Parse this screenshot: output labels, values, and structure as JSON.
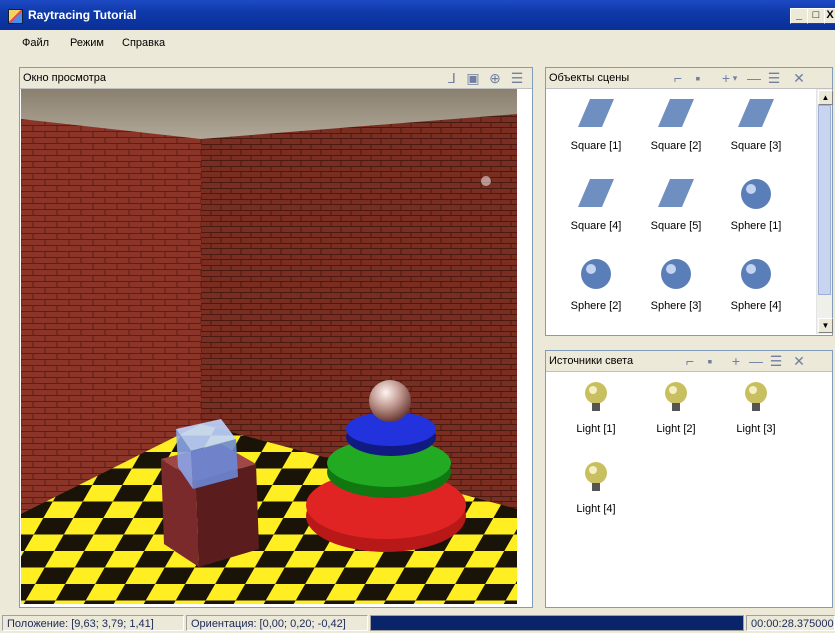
{
  "window": {
    "title": "Raytracing Tutorial",
    "minimize": "_",
    "maximize": "□",
    "close": "X"
  },
  "menu": [
    "Файл",
    "Режим",
    "Справка"
  ],
  "viewport": {
    "title": "Окно просмотра"
  },
  "scene_objects": {
    "title": "Объекты сцены",
    "items": [
      "Square [1]",
      "Square [2]",
      "Square [3]",
      "Square [4]",
      "Square [5]",
      "Sphere [1]",
      "Sphere [2]",
      "Sphere [3]",
      "Sphere [4]"
    ]
  },
  "lights": {
    "title": "Источники света",
    "items": [
      "Light [1]",
      "Light [2]",
      "Light [3]",
      "Light [4]"
    ]
  },
  "status": {
    "position": "Положение: [9,63; 3,79; 1,41]",
    "orientation": "Ориентация: [0,00; 0,20; -0,42]",
    "time": "00:00:28.3750000"
  },
  "colors": {
    "titlebar": "#0f3aa9",
    "progress": "#0a246a",
    "square": "#6f8fc0",
    "sphere": "#5a7fb8",
    "light": "#c8c060"
  }
}
